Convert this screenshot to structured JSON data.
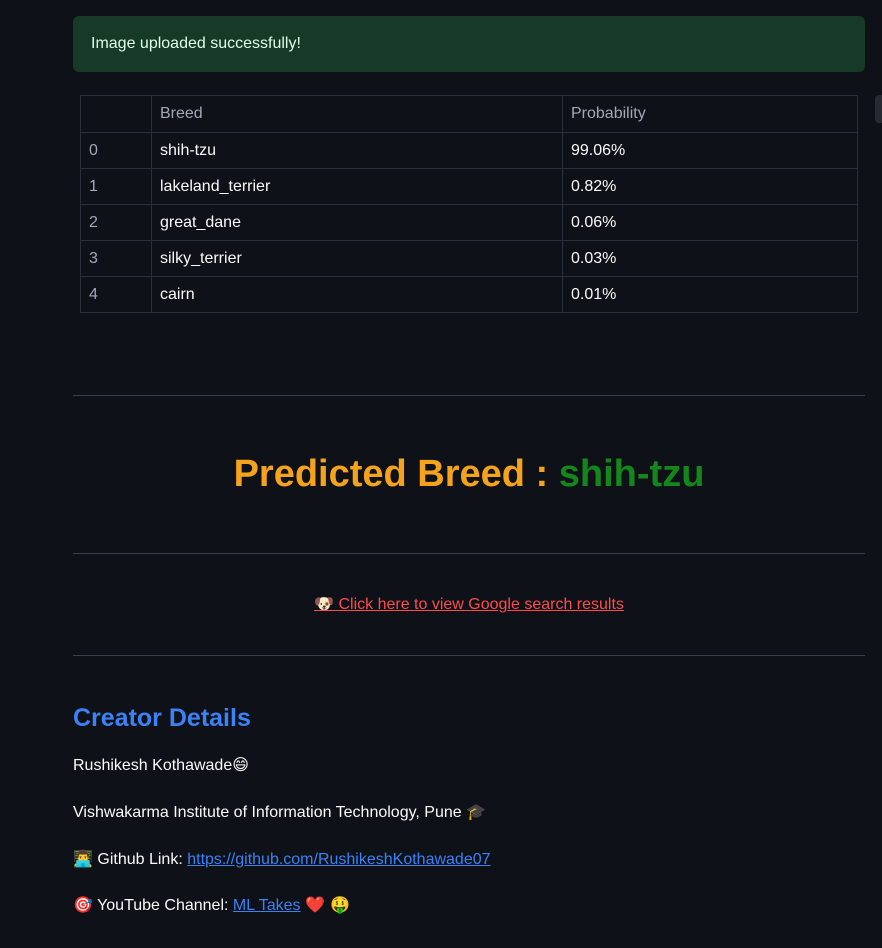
{
  "alert": {
    "message": "Image uploaded successfully!"
  },
  "table": {
    "headers": [
      "",
      "Breed",
      "Probability"
    ],
    "rows": [
      {
        "index": "0",
        "breed": "shih-tzu",
        "probability": "99.06%"
      },
      {
        "index": "1",
        "breed": "lakeland_terrier",
        "probability": "0.82%"
      },
      {
        "index": "2",
        "breed": "great_dane",
        "probability": "0.06%"
      },
      {
        "index": "3",
        "breed": "silky_terrier",
        "probability": "0.03%"
      },
      {
        "index": "4",
        "breed": "cairn",
        "probability": "0.01%"
      }
    ]
  },
  "prediction": {
    "label": "Predicted Breed : ",
    "value": "shih-tzu"
  },
  "search": {
    "icon": "dog-face-icon",
    "icon_glyph": "🐶",
    "label": "Click here to view Google search results"
  },
  "creator": {
    "heading": "Creator Details",
    "name": "Rushikesh Kothawade",
    "name_emoji": "😄",
    "institute": "Vishwakarma Institute of Information Technology, Pune",
    "institute_emoji": "🎓",
    "github_emoji": "👨‍💻",
    "github_label": "Github Link:",
    "github_url": "https://github.com/RushikeshKothawade07",
    "youtube_emoji": "🎯",
    "youtube_label": "YouTube Channel:",
    "youtube_link": "ML Takes",
    "youtube_trailing_emoji": "❤️ 🤑"
  },
  "colors": {
    "background": "#0e1117",
    "success_bg": "#173928",
    "predicted_label": "#f5a21c",
    "predicted_value": "#15861b",
    "link_red": "#ff4b4b",
    "link_blue": "#3b82f6"
  }
}
